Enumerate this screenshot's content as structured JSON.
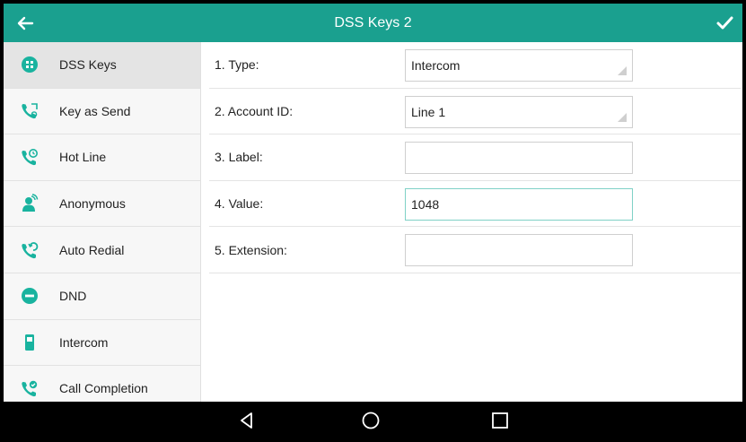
{
  "header": {
    "title": "DSS Keys 2"
  },
  "sidebar": {
    "items": [
      {
        "label": "DSS Keys",
        "icon": "dss-keys-icon",
        "active": true
      },
      {
        "label": "Key as Send",
        "icon": "key-as-send-icon"
      },
      {
        "label": "Hot Line",
        "icon": "hot-line-icon"
      },
      {
        "label": "Anonymous",
        "icon": "anonymous-icon"
      },
      {
        "label": "Auto Redial",
        "icon": "auto-redial-icon"
      },
      {
        "label": "DND",
        "icon": "dnd-icon"
      },
      {
        "label": "Intercom",
        "icon": "intercom-icon"
      },
      {
        "label": "Call Completion",
        "icon": "call-completion-icon"
      }
    ]
  },
  "form": {
    "rows": [
      {
        "label": "1. Type:",
        "value": "Intercom",
        "kind": "select"
      },
      {
        "label": "2. Account ID:",
        "value": "Line 1",
        "kind": "select"
      },
      {
        "label": "3. Label:",
        "value": "",
        "kind": "input"
      },
      {
        "label": "4. Value:",
        "value": "1048",
        "kind": "input",
        "focused": true
      },
      {
        "label": "5. Extension:",
        "value": "",
        "kind": "input"
      }
    ]
  },
  "colors": {
    "accent": "#1aa08f",
    "icon": "#19b39f",
    "navbar": "#000000"
  }
}
